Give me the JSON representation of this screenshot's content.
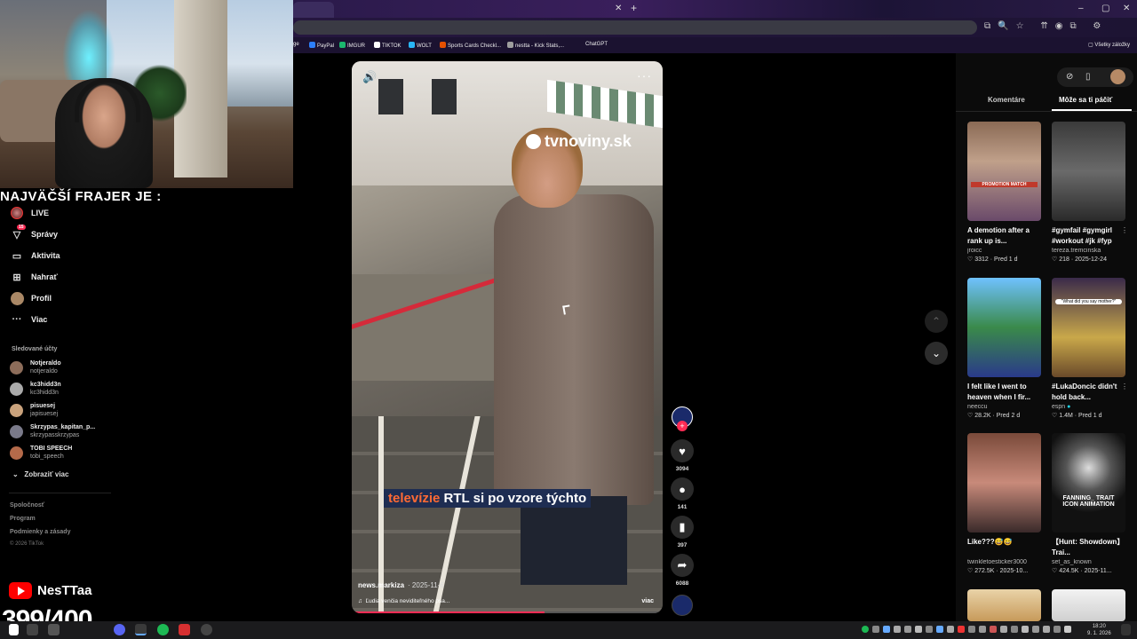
{
  "browser": {
    "bookmarks": [
      {
        "label": "ge",
        "color": "#888888"
      },
      {
        "label": "PayPal",
        "color": "#2d7ff9"
      },
      {
        "label": "IMGUR",
        "color": "#1bb76e"
      },
      {
        "label": "TIKTOK",
        "color": "#ffffff"
      },
      {
        "label": "WOLT",
        "color": "#29b6f6"
      },
      {
        "label": "Sports Cards Checkl...",
        "color": "#e65100"
      },
      {
        "label": "nestta - Kick Stats,...",
        "color": "#9e9e9e"
      },
      {
        "label": "ChatGPT",
        "color": "#ffffff"
      }
    ],
    "all_bookmarks": "Všetky záložky"
  },
  "stream_overlay": {
    "title": "NAJVÄČŠÍ FRAJER JE :",
    "channel": "NesTTaa",
    "counter": "399/400"
  },
  "sidebar": {
    "nav": [
      {
        "label": "LIVE",
        "icon": "live-avatar-icon"
      },
      {
        "label": "Správy",
        "icon": "messages-icon",
        "badge": "15"
      },
      {
        "label": "Aktivita",
        "icon": "activity-icon"
      },
      {
        "label": "Nahrať",
        "icon": "upload-icon"
      },
      {
        "label": "Profil",
        "icon": "profile-avatar-icon"
      },
      {
        "label": "Viac",
        "icon": "more-icon"
      }
    ],
    "following_heading": "Sledované účty",
    "following": [
      {
        "name": "Notjeraldo",
        "user": "notjeraldo"
      },
      {
        "name": "kc3hidd3n",
        "user": "kc3hidd3n"
      },
      {
        "name": "pisuesej",
        "user": "japisuesej"
      },
      {
        "name": "Skrzypas_kapitan_p...",
        "user": "skrzypasskrzypas"
      },
      {
        "name": "TOBI SPEECH",
        "user": "tobi_speech"
      }
    ],
    "show_more": "Zobraziť viac",
    "footer": [
      "Spoločnosť",
      "Program",
      "Podmienky a zásady"
    ],
    "copyright": "© 2026 TikTok"
  },
  "video": {
    "watermark": "tvnoviny.sk",
    "caption_highlight": "televízie",
    "caption_rest": " RTL si po vzore týchto",
    "author": "news.markiza",
    "date": "· 2025-11-6",
    "description": "Ľudia venčia neviditeľného psa...",
    "more": "viac",
    "progress": 0.62,
    "likes": "3094",
    "comments": "141",
    "saves": "397",
    "shares": "6088"
  },
  "right_panel": {
    "tabs": [
      "Komentáre",
      "Môže sa ti páčiť"
    ],
    "active_tab": 1,
    "cards": [
      {
        "title": "A demotion after a rank up is...",
        "user": "jroicc",
        "likes": "3312",
        "date": "Pred 1 d",
        "thumb_text": "PROMOTION MATCH"
      },
      {
        "title": "#gymfail #gymgirl #workout #jk #fyp",
        "user": "tereza.tremcinska",
        "likes": "218",
        "date": "2025-12-24",
        "thumb_text": ""
      },
      {
        "title": "I felt like I went to heaven when I fir...",
        "user": "neeccu",
        "likes": "28.2K",
        "date": "Pred 2 d",
        "thumb_text": ""
      },
      {
        "title": "#LukaDoncic didn't hold back...",
        "user": "espn",
        "likes": "1.4M",
        "date": "Pred 1 d",
        "thumb_text": "\"What did you say mother?\""
      },
      {
        "title": "Like???😅😅",
        "user": "twinkletoesticker3000",
        "likes": "272.5K",
        "date": "2025-10...",
        "thumb_text": ""
      },
      {
        "title": "【Hunt: Showdown】Trai...",
        "user": "set_as_known",
        "likes": "424.5K",
        "date": "2025-11...",
        "thumb_text": "FANNING_ TRAIT ICON ANIMATION"
      }
    ]
  },
  "taskbar": {
    "time": "18:20",
    "date": "9. 1. 2026"
  }
}
